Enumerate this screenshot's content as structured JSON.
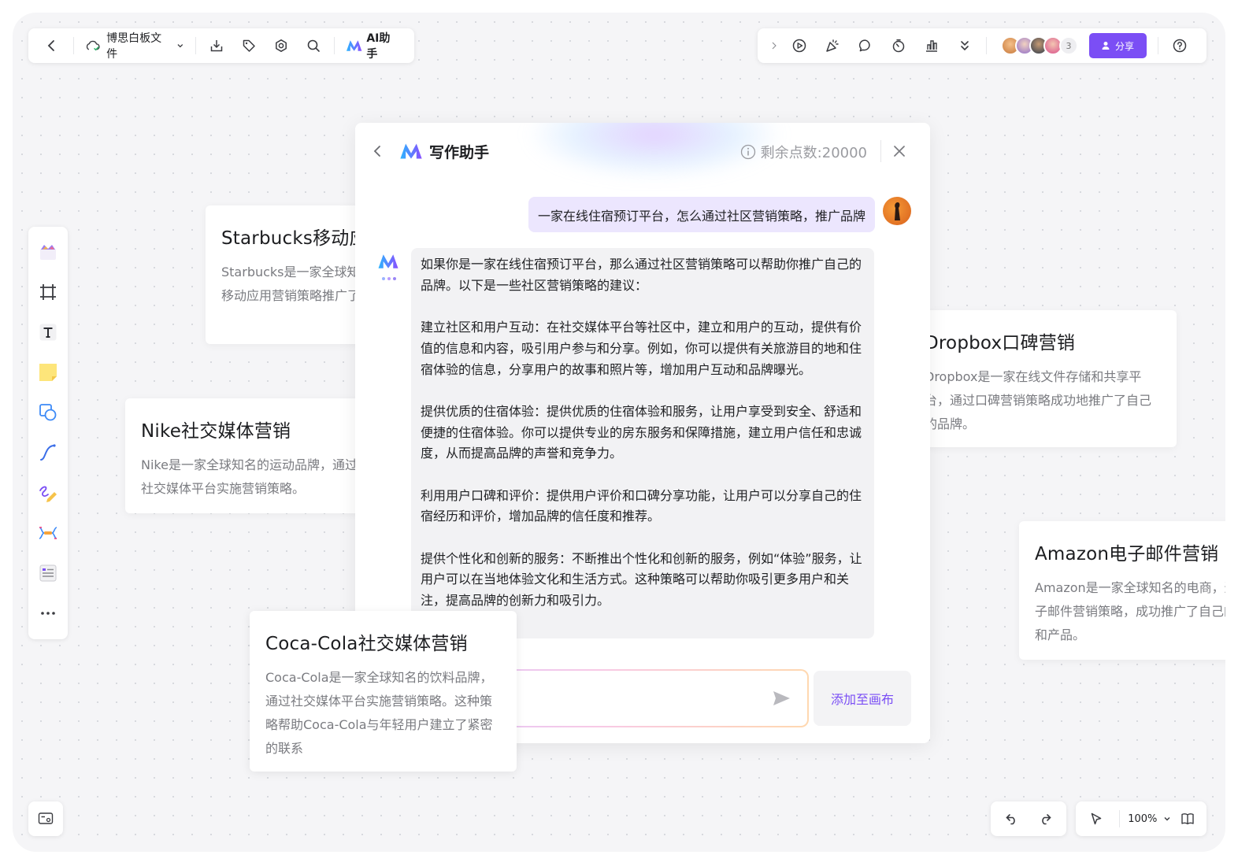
{
  "toolbar": {
    "file_name": "博思白板文件",
    "ai_label": "AI助手",
    "collaborator_extra_count": "3",
    "share_label": "分享"
  },
  "cards": {
    "starbucks": {
      "title": "Starbucks移动应用营销",
      "body": "Starbucks是一家全球知名的咖啡品牌，通过移动应用营销策略推广了自己的品牌。"
    },
    "nike": {
      "title": "Nike社交媒体营销",
      "body": "Nike是一家全球知名的运动品牌，通过社交媒体平台实施营销策略。"
    },
    "dropbox": {
      "title": "Dropbox口碑营销",
      "body": "Dropbox是一家在线文件存储和共享平台，通过口碑营销策略成功地推广了自己的品牌。"
    },
    "amazon": {
      "title": "Amazon电子邮件营销",
      "body": "Amazon是一家全球知名的电商，通过电子邮件营销策略，成功推广了自己的品牌和产品。"
    },
    "cocacola": {
      "title": "Coca-Cola社交媒体营销",
      "body": "Coca-Cola是一家全球知名的饮料品牌，通过社交媒体平台实施营销策略。这种策略帮助Coca-Cola与年轻用户建立了紧密的联系"
    }
  },
  "assistant": {
    "title": "写作助手",
    "credits": "剩余点数:20000",
    "user_message": "一家在线住宿预订平台，怎么通过社区营销策略，推广品牌",
    "reply": [
      "如果你是一家在线住宿预订平台，那么通过社区营销策略可以帮助你推广自己的品牌。以下是一些社区营销策略的建议：",
      "建立社区和用户互动：在社交媒体平台等社区中，建立和用户的互动，提供有价值的信息和内容，吸引用户参与和分享。例如，你可以提供有关旅游目的地和住宿体验的信息，分享用户的故事和照片等，增加用户互动和品牌曝光。",
      "提供优质的住宿体验：提供优质的住宿体验和服务，让用户享受到安全、舒适和便捷的住宿体验。你可以提供专业的房东服务和保障措施，建立用户信任和忠诚度，从而提高品牌的声誉和竞争力。",
      "利用用户口碑和评价：提供用户评价和口碑分享功能，让用户可以分享自己的住宿经历和评价，增加品牌的信任度和推荐。",
      "提供个性化和创新的服务：不断推出个性化和创新的服务，例如“体验”服务，让用户可以在当地体验文化和生活方式。这种策略可以帮助你吸引更多用户和关注，提高品牌的创新力和吸引力。"
    ],
    "add_to_canvas": "添加至画布"
  },
  "zoom": {
    "level": "100%"
  },
  "colors": {
    "accent": "#7b4ef5",
    "canvas": "#f5f5f7",
    "user_bubble": "#ece6fe",
    "ai_bubble": "#f2f2f4"
  }
}
